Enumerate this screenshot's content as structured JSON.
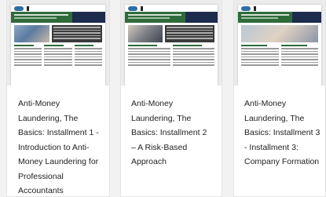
{
  "cards": [
    {
      "title": "Anti-Money Laundering, The Basics: Installment 1 - Introduction to Anti-Money Laundering for Professional Accountants",
      "thumbnail": "document-preview-image"
    },
    {
      "title": "Anti-Money Laundering, The Basics: Installment 2 – A Risk-Based Approach",
      "thumbnail": "document-preview-image"
    },
    {
      "title": "Anti-Money Laundering, The Basics: Installment 3 - Installment 3: Company Formation",
      "thumbnail": "document-preview-image"
    }
  ],
  "colors": {
    "page_background": "#f2f2f2",
    "card_background": "#ffffff",
    "doc_band_green": "#2f6b3a",
    "doc_band_navy": "#1d2b4d"
  }
}
